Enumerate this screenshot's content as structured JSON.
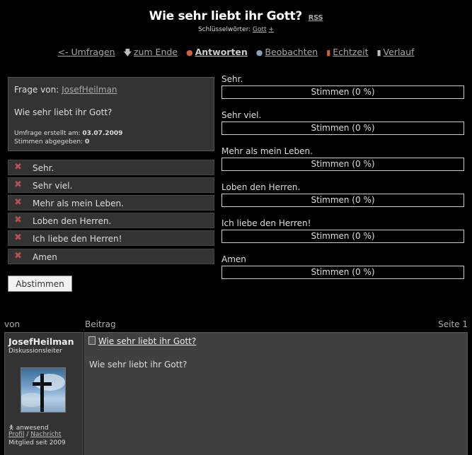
{
  "header": {
    "title": "Wie sehr liebt ihr Gott?",
    "rss": "RSS",
    "keywords_label": "Schlüsselwörter:",
    "keyword": "Gott",
    "keyword_add": "+"
  },
  "nav": {
    "back": "<- Umfragen",
    "to_end": "zum Ende",
    "reply": "Antworten",
    "watch": "Beobachten",
    "realtime": "Echtzeit",
    "history": "Verlauf"
  },
  "question": {
    "from_label": "Frage von:",
    "author": "JosefHeilman",
    "text": "Wie sehr liebt ihr Gott?",
    "created_label": "Umfrage erstellt am:",
    "created_date": "03.07.2009",
    "votes_label": "Stimmen abgegeben:",
    "votes_count": "0"
  },
  "options": [
    {
      "label": "Sehr."
    },
    {
      "label": "Sehr viel."
    },
    {
      "label": "Mehr als mein Leben."
    },
    {
      "label": "Loben den Herren."
    },
    {
      "label": "Ich liebe den Herren!"
    },
    {
      "label": "Amen"
    }
  ],
  "vote_button": "Abstimmen",
  "results": [
    {
      "label": "Sehr.",
      "bar": "Stimmen (0 %)",
      "percent": 0
    },
    {
      "label": "Sehr viel.",
      "bar": "Stimmen (0 %)",
      "percent": 0
    },
    {
      "label": "Mehr als mein Leben.",
      "bar": "Stimmen (0 %)",
      "percent": 0
    },
    {
      "label": "Loben den Herren.",
      "bar": "Stimmen (0 %)",
      "percent": 0
    },
    {
      "label": "Ich liebe den Herren!",
      "bar": "Stimmen (0 %)",
      "percent": 0
    },
    {
      "label": "Amen",
      "bar": "Stimmen (0 %)",
      "percent": 0
    }
  ],
  "thread": {
    "col_from": "von",
    "col_post": "Beitrag",
    "page": "Seite 1"
  },
  "author": {
    "name": "JosefHeilman",
    "role": "Diskussionsleiter",
    "status": "anwesend",
    "profile": "Profil",
    "separator": "/",
    "message": "Nachricht",
    "member_since": "Mitglied seit 2009"
  },
  "post": {
    "title": "Wie sehr liebt ihr Gott?",
    "body": "Wie sehr liebt ihr Gott?"
  }
}
